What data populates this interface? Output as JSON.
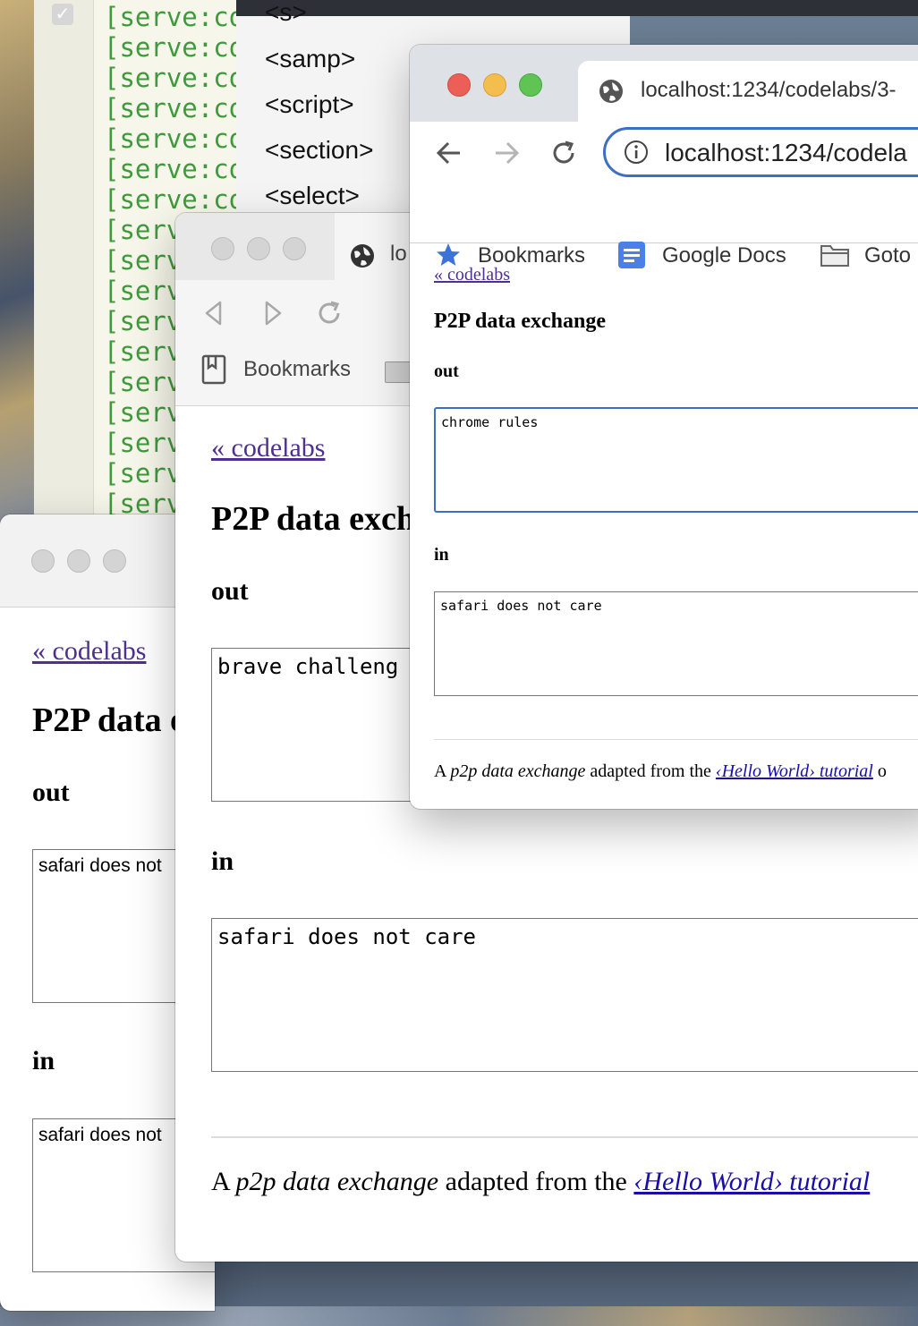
{
  "terminal": {
    "lines": [
      "[serve:coc",
      "[serve:coc",
      "[serve:coc",
      "[serve:coc",
      "[serve:coc",
      "[serve:coc",
      "[serve:coc",
      "[serv",
      "[serv",
      "[serv",
      "[serv",
      "[serv",
      "[serv",
      "[serv",
      "[serv",
      "[serv",
      "[serv"
    ]
  },
  "editor": {
    "tags": [
      "<s>",
      "<samp>",
      "<script>",
      "<section>",
      "<select>"
    ]
  },
  "chrome_window": {
    "tab_title": "localhost:1234/codelabs/3-",
    "url": "localhost:1234/codela",
    "bookmarks": [
      "Bookmarks",
      "Google Docs",
      "Goto"
    ],
    "page": {
      "back_link": "« codelabs",
      "title": "P2P data exchange",
      "out_label": "out",
      "out_value": "chrome rules",
      "in_label": "in",
      "in_value": "safari does not care",
      "footer_a": "A",
      "footer_em": "p2p data exchange",
      "footer_mid": "adapted from the",
      "footer_link": "‹Hello World› tutorial",
      "footer_tail": "o"
    }
  },
  "brave_window": {
    "tab_title": "lo",
    "bookmarks": "Bookmarks",
    "page": {
      "back_link": "« codelabs",
      "title": "P2P data exch",
      "out_label": "out",
      "out_value": "brave challeng",
      "in_label": "in",
      "in_value": "safari does not care",
      "footer_a": "A",
      "footer_em": "p2p data exchange",
      "footer_mid": "adapted from the",
      "footer_link": "‹Hello World› tutorial"
    }
  },
  "safari_window": {
    "page": {
      "back_link": "« codelabs",
      "title": "P2P data e",
      "out_label": "out",
      "out_value": "safari does not",
      "in_label": "in",
      "in_value": "safari does not"
    }
  }
}
